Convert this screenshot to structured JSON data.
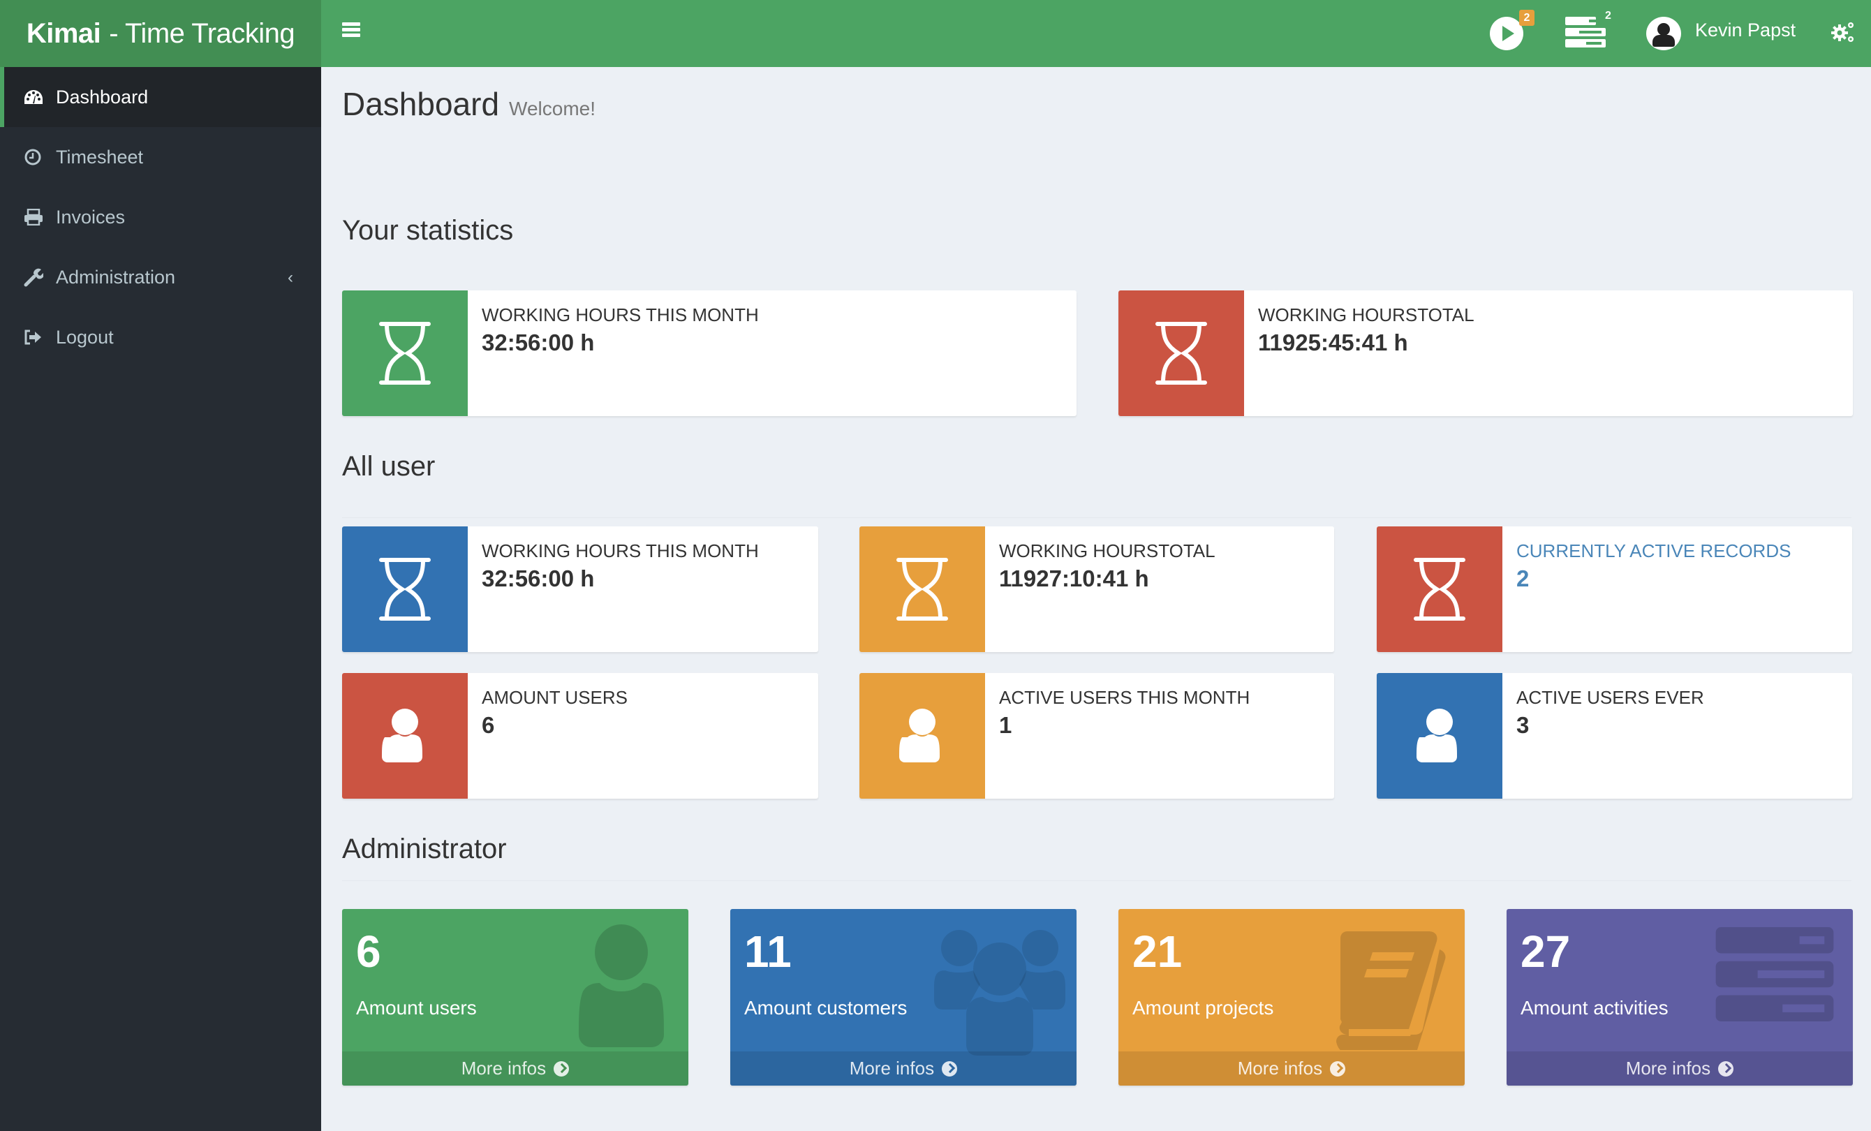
{
  "app": {
    "brand_bold": "Kimai",
    "brand_light": "- Time Tracking"
  },
  "navbar": {
    "active_records_count": "2",
    "tasks_count": "2",
    "user_name": "Kevin Papst"
  },
  "sidebar": {
    "items": [
      {
        "label": "Dashboard",
        "icon": "dashboard-icon",
        "active": true
      },
      {
        "label": "Timesheet",
        "icon": "clock-icon"
      },
      {
        "label": "Invoices",
        "icon": "printer-icon"
      },
      {
        "label": "Administration",
        "icon": "wrench-icon",
        "has_submenu": true
      },
      {
        "label": "Logout",
        "icon": "sign-out-icon"
      }
    ]
  },
  "page": {
    "title": "Dashboard",
    "subtitle": "Welcome!"
  },
  "sections": {
    "your_statistics": {
      "title": "Your statistics",
      "boxes": [
        {
          "label": "WORKING HOURS THIS MONTH",
          "value": "32:56:00 h",
          "color": "#4ca463",
          "icon": "hourglass-icon"
        },
        {
          "label": "WORKING HOURSTOTAL",
          "value": "11925:45:41 h",
          "color": "#cb5442",
          "icon": "hourglass-icon"
        }
      ]
    },
    "all_user": {
      "title": "All user",
      "boxes": [
        {
          "label": "WORKING HOURS THIS MONTH",
          "value": "32:56:00 h",
          "color": "#3272b2",
          "icon": "hourglass-icon"
        },
        {
          "label": "WORKING HOURSTOTAL",
          "value": "11927:10:41 h",
          "color": "#e79f3c",
          "icon": "hourglass-icon"
        },
        {
          "label": "CURRENTLY ACTIVE RECORDS",
          "value": "2",
          "color": "#cb5442",
          "icon": "hourglass-icon",
          "link": true
        },
        {
          "label": "AMOUNT USERS",
          "value": "6",
          "color": "#cb5442",
          "icon": "user-icon"
        },
        {
          "label": "ACTIVE USERS THIS MONTH",
          "value": "1",
          "color": "#e79f3c",
          "icon": "user-icon"
        },
        {
          "label": "ACTIVE USERS EVER",
          "value": "3",
          "color": "#3272b2",
          "icon": "user-icon"
        }
      ]
    },
    "administrator": {
      "title": "Administrator",
      "boxes": [
        {
          "number": "6",
          "text": "Amount users",
          "footer": "More infos",
          "color": "#4ca463",
          "icon": "user-icon"
        },
        {
          "number": "11",
          "text": "Amount customers",
          "footer": "More infos",
          "color": "#3272b2",
          "icon": "users-icon"
        },
        {
          "number": "21",
          "text": "Amount projects",
          "footer": "More infos",
          "color": "#e79f3c",
          "icon": "book-icon"
        },
        {
          "number": "27",
          "text": "Amount activities",
          "footer": "More infos",
          "color": "#605ea3",
          "icon": "tasks-icon"
        }
      ]
    }
  }
}
